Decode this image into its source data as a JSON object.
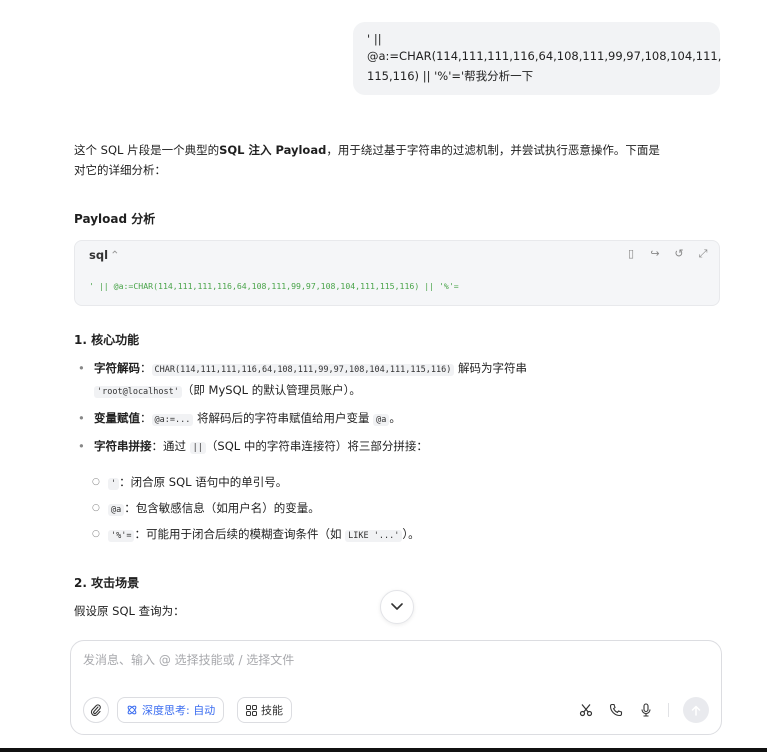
{
  "user_message": {
    "line1": "' ||",
    "line2": "@a:=CHAR(114,111,111,116,64,108,111,99,97,108,104,111,",
    "line3": "115,116) || '%'='帮我分析一下"
  },
  "answer": {
    "intro_1": "这个 SQL 片段是一个典型的",
    "intro_bold": "SQL 注入 Payload",
    "intro_2": "，用于绕过基于字符串的过滤机制，并尝试执行恶意操作。下面是",
    "intro_3": "对它的详细分析：",
    "section_payload": "Payload 分析",
    "code": {
      "lang": "sql",
      "line": "' || @a:=CHAR(114,111,111,116,64,108,111,99,97,108,104,111,115,116) || '%'="
    },
    "section_core": "1. 核心功能",
    "items": {
      "decode_label": "字符解码",
      "decode_code": "CHAR(114,111,111,116,64,108,111,99,97,108,104,111,115,116)",
      "decode_text": " 解码为字符串",
      "decode_code2": "'root@localhost'",
      "decode_text2": "（即 MySQL 的默认管理员账户）。",
      "assign_label": "变量赋值",
      "assign_code": "@a:=...",
      "assign_text": " 将解码后的字符串赋值给用户变量 ",
      "assign_code2": "@a",
      "assign_text2": "。",
      "concat_label": "字符串拼接",
      "concat_text1": "：通过 ",
      "concat_code": "||",
      "concat_text2": "（SQL 中的字符串连接符）将三部分拼接：",
      "sub1_code": "'",
      "sub1_text": "：闭合原 SQL 语句中的单引号。",
      "sub2_code": "@a",
      "sub2_text": "：包含敏感信息（如用户名）的变量。",
      "sub3_code": "'%'=",
      "sub3_text": "：可能用于闭合后续的模糊查询条件（如 ",
      "sub3_code2": "LIKE '...'",
      "sub3_text2": "）。"
    },
    "section_attack": "2. 攻击场景",
    "attack_text": "假设原 SQL 查询为："
  },
  "composer": {
    "placeholder": "发消息、输入 @ 选择技能或 / 选择文件",
    "deep_think": "深度思考: 自动",
    "skill": "技能"
  },
  "colors": {
    "code_green": "#4aa44a",
    "accent_blue": "#3b6df0",
    "bubble_bg": "#f2f3f5"
  }
}
